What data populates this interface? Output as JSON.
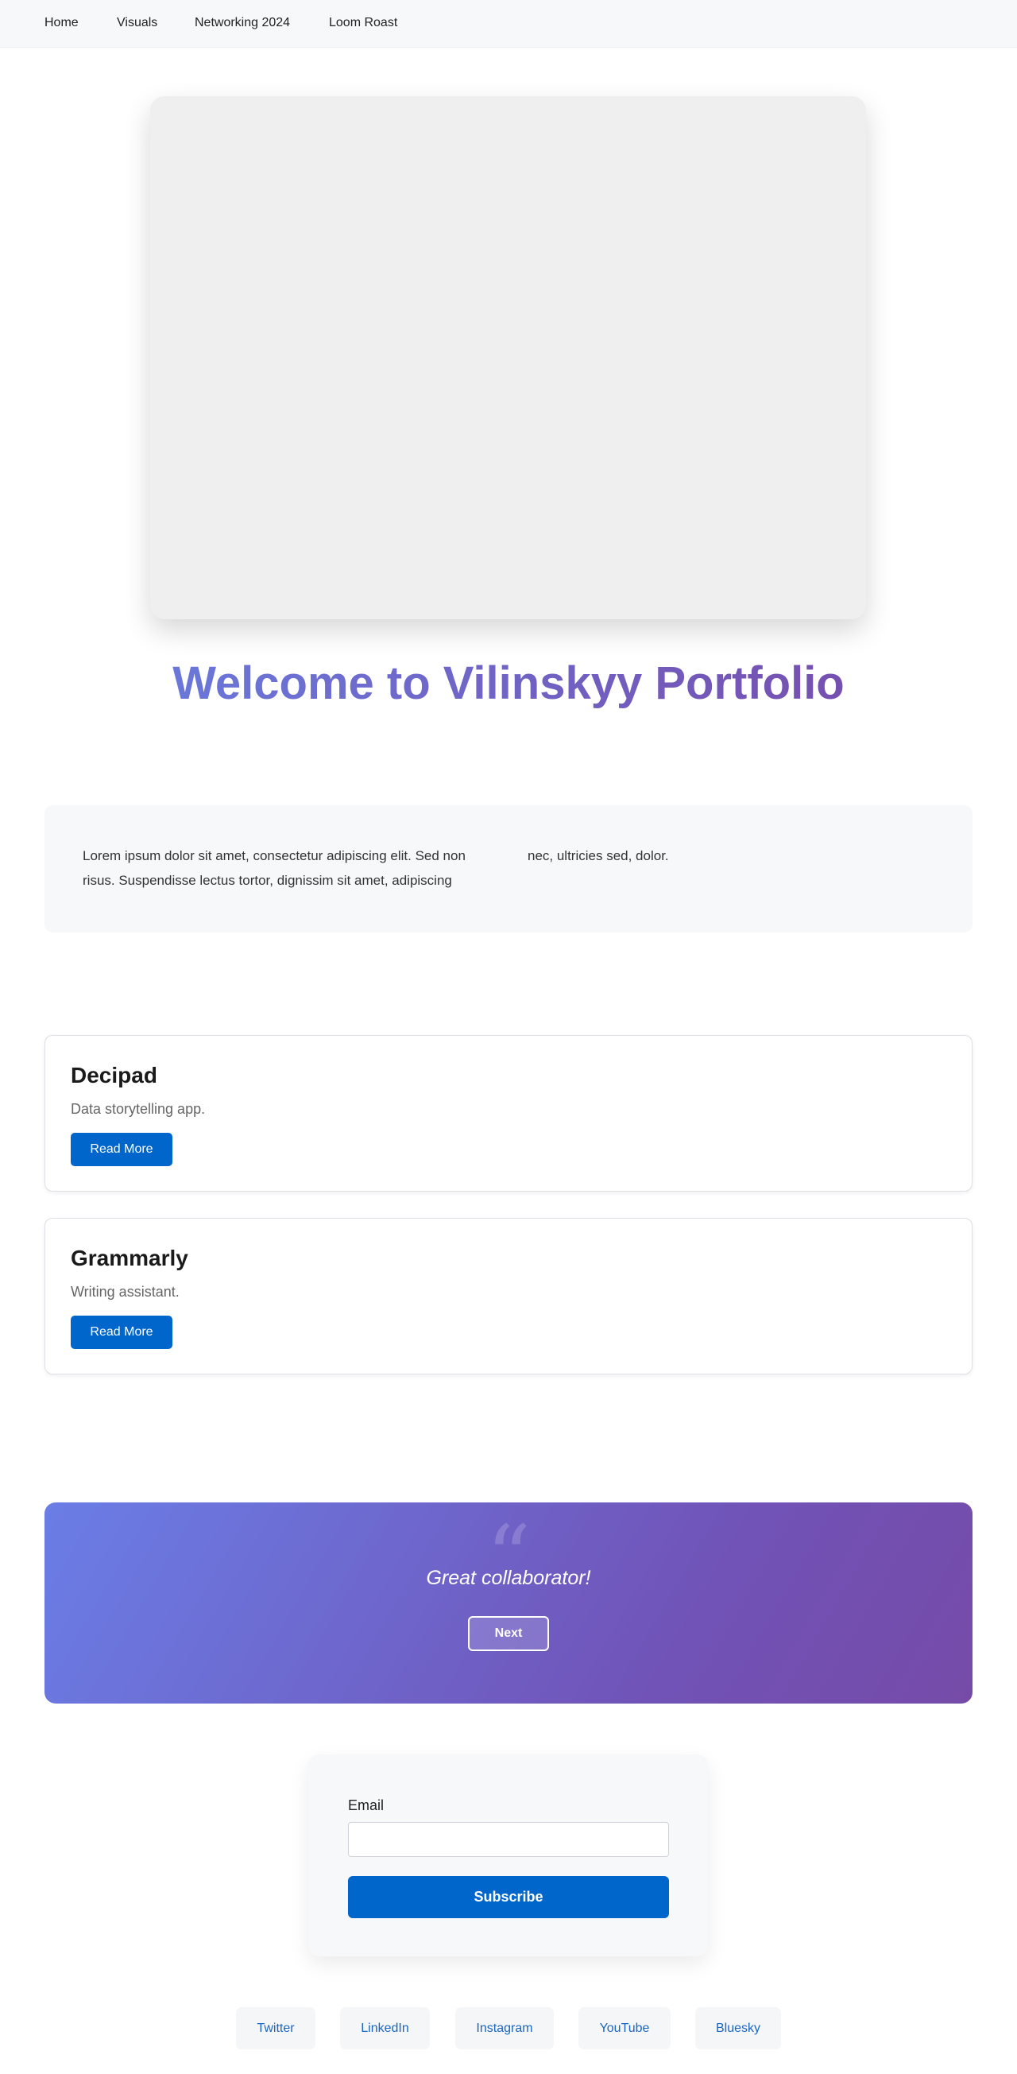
{
  "nav": {
    "items": [
      "Home",
      "Visuals",
      "Networking 2024",
      "Loom Roast"
    ]
  },
  "hero": {
    "title": "Welcome to Vilinskyy Portfolio"
  },
  "intro": {
    "text": "Lorem ipsum dolor sit amet, consectetur adipiscing elit. Sed non risus. Suspendisse lectus tortor, dignissim sit amet, adipiscing",
    "text_continued": "nec, ultricies sed, dolor."
  },
  "projects": [
    {
      "title": "Decipad",
      "description": "Data storytelling app.",
      "button": "Read More"
    },
    {
      "title": "Grammarly",
      "description": "Writing assistant.",
      "button": "Read More"
    }
  ],
  "testimonial": {
    "quote": "Great collaborator!",
    "next_label": "Next"
  },
  "subscribe": {
    "email_label": "Email",
    "email_value": "",
    "button": "Subscribe"
  },
  "social": [
    "Twitter",
    "LinkedIn",
    "Instagram",
    "YouTube",
    "Bluesky"
  ],
  "colors": {
    "accent": "#0066cc",
    "gradient_start": "#667eea",
    "gradient_end": "#764ba2"
  }
}
